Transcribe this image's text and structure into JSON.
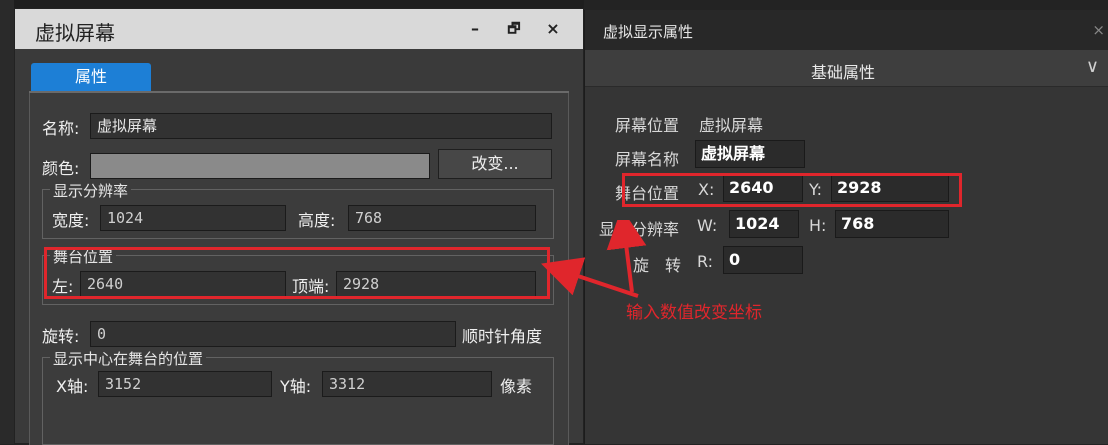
{
  "dialog": {
    "title": "虚拟屏幕",
    "minimize_label": "–",
    "restore_label": "🗗",
    "close_label": "×",
    "tab_label": "属性",
    "name_label": "名称:",
    "name_value": "虚拟屏幕",
    "color_label": "颜色:",
    "color_swatch": "#8a8a8a",
    "change_button_label": "改变...",
    "resolution": {
      "title": "显示分辨率",
      "width_label": "宽度:",
      "width_value": "1024",
      "height_label": "高度:",
      "height_value": "768"
    },
    "stage_position": {
      "title": "舞台位置",
      "left_label": "左:",
      "left_value": "2640",
      "top_label": "顶端:",
      "top_value": "2928"
    },
    "rotation": {
      "label": "旋转:",
      "value": "0",
      "unit": "顺时针角度"
    },
    "center": {
      "title": "显示中心在舞台的位置",
      "x_label": "X轴:",
      "x_value": "3152",
      "y_label": "Y轴:",
      "y_value": "3312",
      "unit": "像素"
    }
  },
  "panel": {
    "title": "虚拟显示属性",
    "close_label": "×",
    "section_title": "基础属性",
    "chevron": "∨",
    "screen_position_label": "屏幕位置",
    "screen_position_value": "虚拟屏幕",
    "screen_name_label": "屏幕名称",
    "screen_name_value": "虚拟屏幕",
    "stage_label": "舞台位置",
    "x_label": "X:",
    "x_value": "2640",
    "y_label": "Y:",
    "y_value": "2928",
    "resolution_label": "显示分辨率",
    "w_label": "W:",
    "w_value": "1024",
    "h_label": "H:",
    "h_value": "768",
    "rotate_label": "旋　转",
    "r_label": "R:",
    "r_value": "0"
  },
  "annotation": {
    "text": "输入数值改变坐标",
    "color": "#e0262c"
  }
}
